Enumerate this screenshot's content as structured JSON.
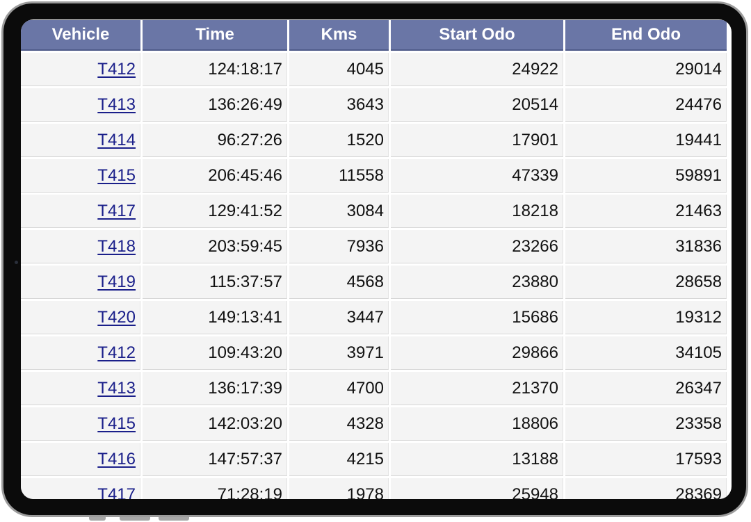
{
  "table": {
    "headers": [
      "Vehicle",
      "Time",
      "Kms",
      "Start Odo",
      "End Odo"
    ],
    "rows": [
      {
        "vehicle": "T412",
        "time": "124:18:17",
        "kms": "4045",
        "start_odo": "24922",
        "end_odo": "29014"
      },
      {
        "vehicle": "T413",
        "time": "136:26:49",
        "kms": "3643",
        "start_odo": "20514",
        "end_odo": "24476"
      },
      {
        "vehicle": "T414",
        "time": "96:27:26",
        "kms": "1520",
        "start_odo": "17901",
        "end_odo": "19441"
      },
      {
        "vehicle": "T415",
        "time": "206:45:46",
        "kms": "11558",
        "start_odo": "47339",
        "end_odo": "59891"
      },
      {
        "vehicle": "T417",
        "time": "129:41:52",
        "kms": "3084",
        "start_odo": "18218",
        "end_odo": "21463"
      },
      {
        "vehicle": "T418",
        "time": "203:59:45",
        "kms": "7936",
        "start_odo": "23266",
        "end_odo": "31836"
      },
      {
        "vehicle": "T419",
        "time": "115:37:57",
        "kms": "4568",
        "start_odo": "23880",
        "end_odo": "28658"
      },
      {
        "vehicle": "T420",
        "time": "149:13:41",
        "kms": "3447",
        "start_odo": "15686",
        "end_odo": "19312"
      },
      {
        "vehicle": "T412",
        "time": "109:43:20",
        "kms": "3971",
        "start_odo": "29866",
        "end_odo": "34105"
      },
      {
        "vehicle": "T413",
        "time": "136:17:39",
        "kms": "4700",
        "start_odo": "21370",
        "end_odo": "26347"
      },
      {
        "vehicle": "T415",
        "time": "142:03:20",
        "kms": "4328",
        "start_odo": "18806",
        "end_odo": "23358"
      },
      {
        "vehicle": "T416",
        "time": "147:57:37",
        "kms": "4215",
        "start_odo": "13188",
        "end_odo": "17593"
      },
      {
        "vehicle": "T417",
        "time": "71:28:19",
        "kms": "1978",
        "start_odo": "25948",
        "end_odo": "28369"
      }
    ]
  },
  "colors": {
    "header_bg": "#6a76a6",
    "header_text": "#ffffff",
    "cell_bg": "#f4f4f4",
    "link": "#1a1f8a"
  }
}
